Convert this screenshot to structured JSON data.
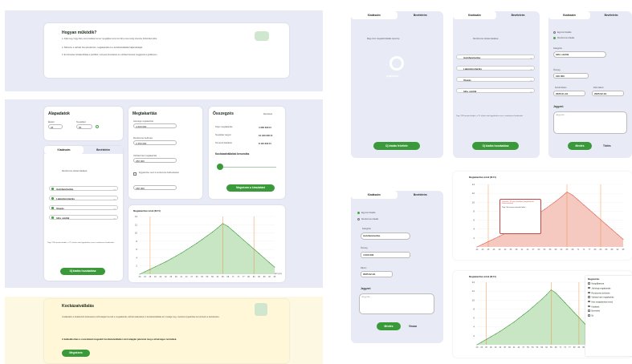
{
  "how": {
    "title": "Hogyan működik?",
    "p1": "1. Adja meg, hogy hány éves korában tervez nyugdíjba menni és hány éves korig szeretne biztosítást kötni.",
    "p2": "2. Állítsa be a várható havi jövedelmet, megtakarítást és a kockázatvállalási hajlandóságát.",
    "p3": "3. Ezt követően kiválaszthatja a portfóliót, melynek összetétele és várható hozama megjelenik a grafikonon."
  },
  "basics": {
    "title": "Alapadatok",
    "age_label": "Életkor",
    "age": "26",
    "retire_label": "Nyugdíjkor",
    "retire": "65",
    "unit": "év"
  },
  "savings": {
    "title": "Megtakarítás",
    "f1_label": "Jelenlegi megtakarítás",
    "f1": "4 200 000",
    "f2_label": "Rendszeres befizetés",
    "f2": "2 450 000",
    "f3_label": "Várható havi megtakarítás",
    "f3": "260 000",
    "check_label": "Figyelembe veszi a rendszeres befizetéseket",
    "f4": "180 000",
    "unit": "Ft"
  },
  "summary": {
    "title": "Összegzés",
    "link": "Részletek",
    "r1_label": "Teljes megtakarítás",
    "r1": "4 300 000 Ft",
    "r2_label": "Nyugdíjas vagyon",
    "r2": "12 420 000 Ft",
    "r3_label": "Teruezett kiadások",
    "r3": "8 110 000 Ft",
    "risk_label": "Kockázatvállalási besorolás",
    "button": "Megnézem a kimutatást"
  },
  "tabs": {
    "expenses": "Kiadásaim",
    "income": "Bevételeim"
  },
  "list": {
    "title": "Rendszeres tételek kiadásai",
    "items": [
      "Autófenntartás",
      "Lakásfenntartás",
      "Utazás",
      "Idős szülők"
    ],
    "tip": "Tipp: 370 havonta kiadás, a 75. életév után figyelembe veszi a rendszeres kiadásokat.",
    "button": "Új kiadás hozzáadása"
  },
  "chart": {
    "title": "Megtakarítási érték (M Ft)",
    "unit": "Életkor (év)"
  },
  "chart_data": {
    "type": "line",
    "x": [
      "20",
      "23",
      "25",
      "26",
      "29",
      "32",
      "35",
      "38",
      "41",
      "44",
      "47",
      "50",
      "53",
      "56",
      "59",
      "62",
      "65",
      "68",
      "71",
      "74",
      "77",
      "80",
      "83",
      "86",
      "89",
      "92",
      "95"
    ],
    "y_ticks": [
      "2",
      "4",
      "6",
      "8",
      "10",
      "12",
      "14"
    ],
    "series": [
      {
        "values": [
          0,
          0.6,
          1.2,
          1.8,
          2.4,
          3.0,
          3.7,
          4.4,
          5.1,
          5.9,
          6.7,
          7.5,
          8.4,
          9.3,
          10.2,
          11.2,
          12.3,
          11.6,
          10.5,
          9.4,
          8.3,
          7.2,
          6.1,
          5.0,
          3.9,
          2.8,
          1.7
        ]
      }
    ]
  },
  "risk": {
    "title": "Kockázatvállalás",
    "p1": "A kalkulátor a kiválasztott befektetési profil alapján becsüli a megtakarítás várható alakulását. A kockázatvállalás azt mutatja meg, mekkora ingadozást tud elviselni a befektetése.",
    "p2": "A kalkulátorban a csúszkával megadott kockázatvállalási szint alapján jelennek meg a lehetséges termékek.",
    "button": "Megnézem"
  },
  "empty": {
    "text": "Még nincs megadott kiadás tervezve",
    "logo": "otpbank",
    "button": "Új kiadás felvétele"
  },
  "form": {
    "r1": "Egyszeri kiadás",
    "r2": "Rendszeres kiadás",
    "cat_label": "Kategória",
    "cat": "Idős szülők",
    "amount_label": "Összeg",
    "amount": "100 000",
    "start_label": "Kezdő dátum",
    "start": "2025.01.16.",
    "end_label": "Záró dátum",
    "end": "2025.02.16.",
    "note_label": "Jegyzet:",
    "note_ph": "Jegyzet...",
    "save": "Mentés",
    "cancel": "Törlés"
  },
  "form2": {
    "cat": "Autófenntartás",
    "amount": "4 000 000",
    "date_label": "Dátum",
    "date": "2025.02.16.",
    "save": "Mentés",
    "cancel": "Vissza"
  },
  "tooltip": {
    "t1": "Vásárlás: 32 éves korában (megtakarítás felhasználása)",
    "t2": "Tipp: 30 évesen vásárolt lakás"
  },
  "legend": {
    "title": "Megjelenítés",
    "items": [
      "Nyugdíjkassza",
      "Jelenlegi megtakarítás",
      "Rendszeres befizetés",
      "Várható havi megtakarítás",
      "Havi megtakarítás (éves)",
      "Kiadások",
      "Bevételek",
      "Ez"
    ]
  }
}
